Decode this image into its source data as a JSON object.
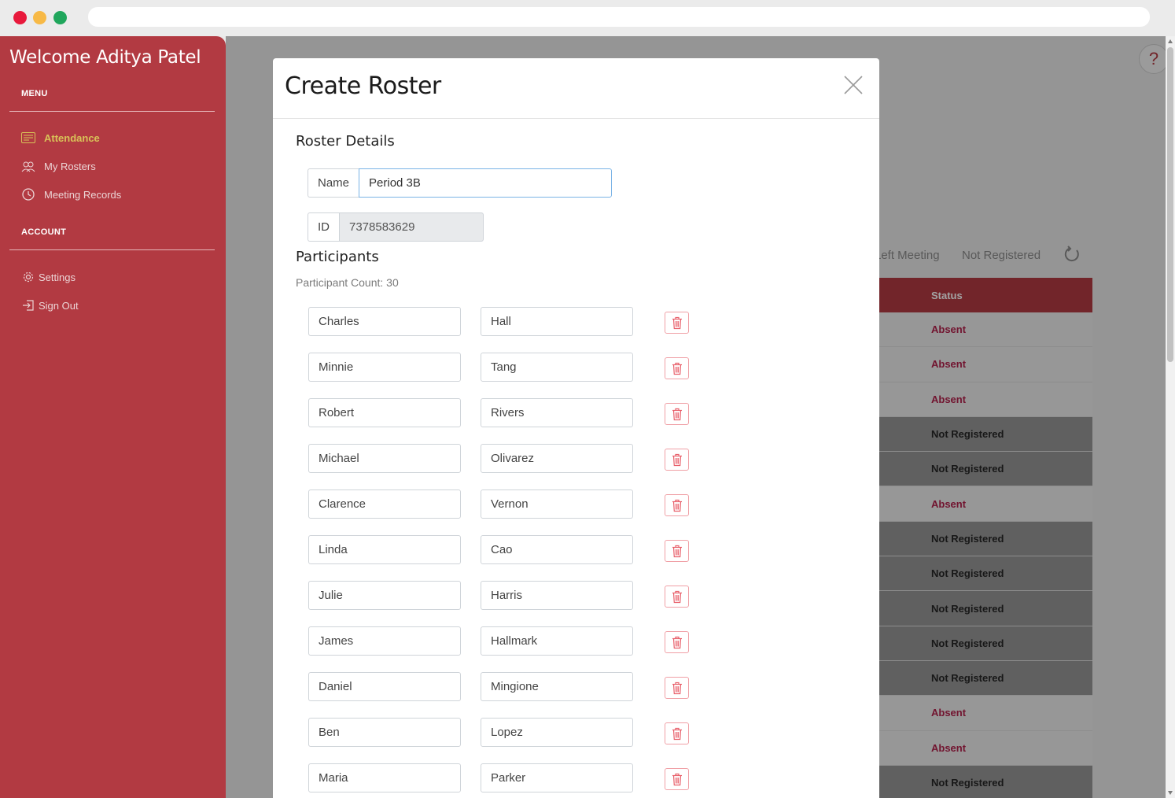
{
  "sidebar": {
    "welcome": "Welcome Aditya Patel",
    "menu_heading": "MENU",
    "menu_items": [
      {
        "label": "Attendance",
        "icon": "calendar-icon",
        "active": true
      },
      {
        "label": "My Rosters",
        "icon": "users-icon",
        "active": false
      },
      {
        "label": "Meeting Records",
        "icon": "clock-icon",
        "active": false
      }
    ],
    "account_heading": "ACCOUNT",
    "account_items": [
      {
        "label": "Settings",
        "icon": "gear-icon"
      },
      {
        "label": "Sign Out",
        "icon": "sign-out-icon"
      }
    ]
  },
  "background": {
    "filter_tabs": [
      "Left Meeting",
      "Not Registered"
    ],
    "help_label": "?",
    "status_header": "Status",
    "statuses": [
      "Absent",
      "Absent",
      "Absent",
      "Not Registered",
      "Not Registered",
      "Absent",
      "Not Registered",
      "Not Registered",
      "Not Registered",
      "Not Registered",
      "Not Registered",
      "Absent",
      "Absent",
      "Not Registered"
    ]
  },
  "modal": {
    "title": "Create Roster",
    "details_heading": "Roster Details",
    "name_label": "Name",
    "name_value": "Period 3B",
    "id_label": "ID",
    "id_value": "7378583629",
    "participants_heading": "Participants",
    "participant_count_text": "Participant Count: 30",
    "participants": [
      {
        "first": "Charles",
        "last": "Hall"
      },
      {
        "first": "Minnie",
        "last": "Tang"
      },
      {
        "first": "Robert",
        "last": "Rivers"
      },
      {
        "first": "Michael",
        "last": "Olivarez"
      },
      {
        "first": "Clarence",
        "last": "Vernon"
      },
      {
        "first": "Linda",
        "last": "Cao"
      },
      {
        "first": "Julie",
        "last": "Harris"
      },
      {
        "first": "James",
        "last": "Hallmark"
      },
      {
        "first": "Daniel",
        "last": "Mingione"
      },
      {
        "first": "Ben",
        "last": "Lopez"
      },
      {
        "first": "Maria",
        "last": "Parker"
      }
    ]
  },
  "colors": {
    "sidebar": "#b23a42",
    "active_item": "#d8c258",
    "absent": "#b2214c",
    "delete_icon": "#e8606b"
  }
}
